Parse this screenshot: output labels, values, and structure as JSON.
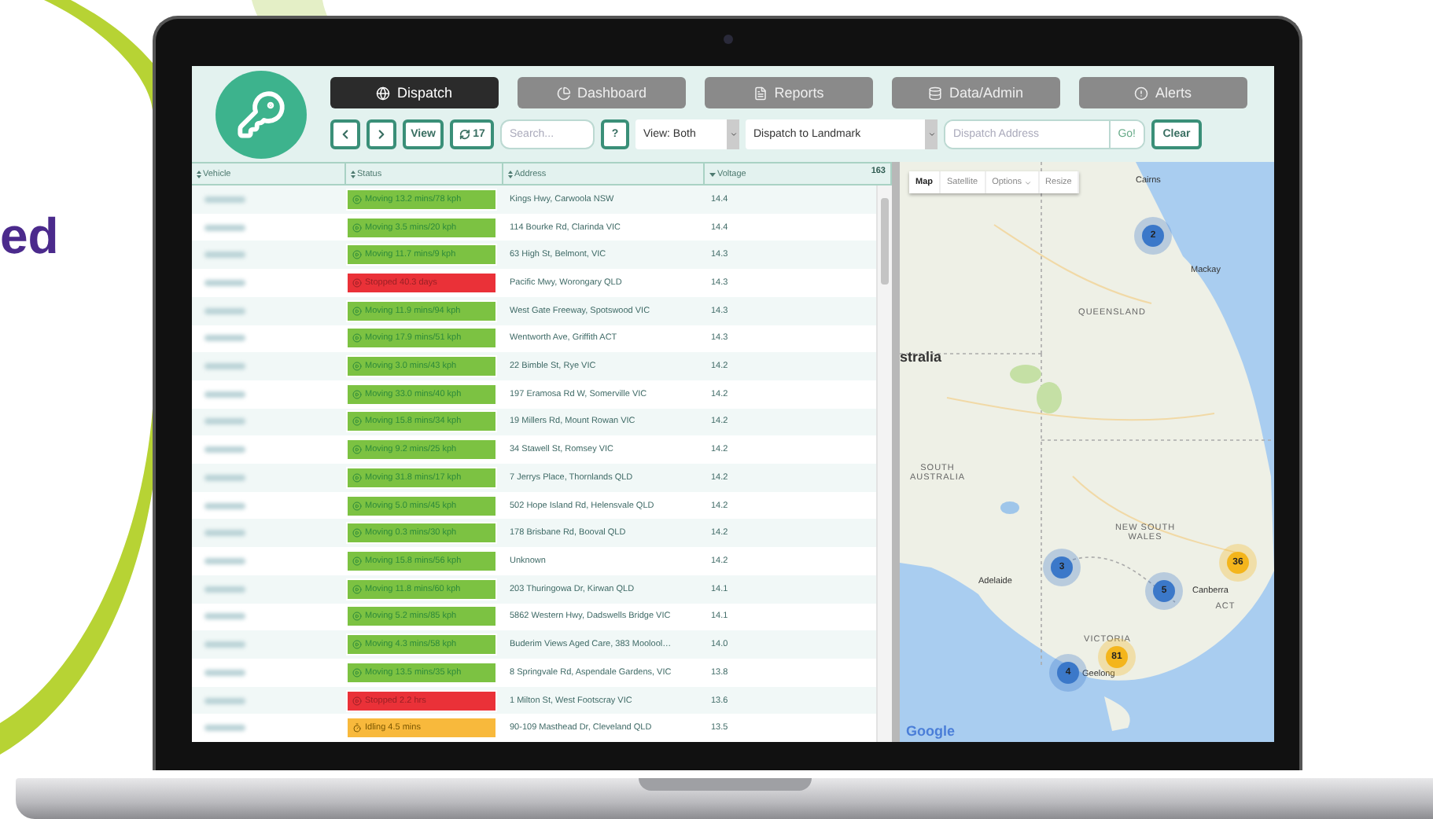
{
  "side_text": "ed",
  "nav": [
    {
      "label": "Dispatch",
      "selected": true
    },
    {
      "label": "Dashboard",
      "selected": false
    },
    {
      "label": "Reports",
      "selected": false
    },
    {
      "label": "Data/Admin",
      "selected": false
    },
    {
      "label": "Alerts",
      "selected": false
    }
  ],
  "toolbar": {
    "view_button": "View",
    "refresh_count": "17",
    "search": {
      "placeholder": "Search..."
    },
    "help_button": "?",
    "view_select": "View: Both",
    "dispatch_select": "Dispatch to Landmark",
    "address": {
      "placeholder": "Dispatch Address"
    },
    "go_button": "Go!",
    "clear_button": "Clear"
  },
  "table": {
    "columns": [
      {
        "label": "Vehicle",
        "sorted": false
      },
      {
        "label": "Status",
        "sorted": false
      },
      {
        "label": "Address",
        "sorted": false
      },
      {
        "label": "Voltage",
        "sorted": true
      }
    ],
    "count": "163",
    "rows": [
      {
        "status": {
          "kind": "moving",
          "text": "Moving 13.2 mins/78 kph"
        },
        "address": "Kings Hwy, Carwoola NSW",
        "voltage": "14.4"
      },
      {
        "status": {
          "kind": "moving",
          "text": "Moving 3.5 mins/20 kph"
        },
        "address": "114 Bourke Rd, Clarinda VIC",
        "voltage": "14.4"
      },
      {
        "status": {
          "kind": "moving",
          "text": "Moving 11.7 mins/9 kph"
        },
        "address": "63 High St, Belmont, VIC",
        "voltage": "14.3"
      },
      {
        "status": {
          "kind": "stopped",
          "text": "Stopped 40.3 days"
        },
        "address": "Pacific Mwy, Worongary QLD",
        "voltage": "14.3"
      },
      {
        "status": {
          "kind": "moving",
          "text": "Moving 11.9 mins/94 kph"
        },
        "address": "West Gate Freeway, Spotswood VIC",
        "voltage": "14.3"
      },
      {
        "status": {
          "kind": "moving",
          "text": "Moving 17.9 mins/51 kph"
        },
        "address": "Wentworth Ave, Griffith ACT",
        "voltage": "14.3"
      },
      {
        "status": {
          "kind": "moving",
          "text": "Moving 3.0 mins/43 kph"
        },
        "address": "22 Bimble St, Rye VIC",
        "voltage": "14.2"
      },
      {
        "status": {
          "kind": "moving",
          "text": "Moving 33.0 mins/40 kph"
        },
        "address": "197 Eramosa Rd W, Somerville VIC",
        "voltage": "14.2"
      },
      {
        "status": {
          "kind": "moving",
          "text": "Moving 15.8 mins/34 kph"
        },
        "address": "19 Millers Rd, Mount Rowan VIC",
        "voltage": "14.2"
      },
      {
        "status": {
          "kind": "moving",
          "text": "Moving 9.2 mins/25 kph"
        },
        "address": "34 Stawell St, Romsey VIC",
        "voltage": "14.2"
      },
      {
        "status": {
          "kind": "moving",
          "text": "Moving 31.8 mins/17 kph"
        },
        "address": "7 Jerrys Place, Thornlands QLD",
        "voltage": "14.2"
      },
      {
        "status": {
          "kind": "moving",
          "text": "Moving 5.0 mins/45 kph"
        },
        "address": "502 Hope Island Rd, Helensvale QLD",
        "voltage": "14.2"
      },
      {
        "status": {
          "kind": "moving",
          "text": "Moving 0.3 mins/30 kph"
        },
        "address": "178 Brisbane Rd, Booval QLD",
        "voltage": "14.2"
      },
      {
        "status": {
          "kind": "moving",
          "text": "Moving 15.8 mins/56 kph"
        },
        "address": "Unknown",
        "voltage": "14.2"
      },
      {
        "status": {
          "kind": "moving",
          "text": "Moving 11.8 mins/60 kph"
        },
        "address": "203 Thuringowa Dr, Kirwan QLD",
        "voltage": "14.1"
      },
      {
        "status": {
          "kind": "moving",
          "text": "Moving 5.2 mins/85 kph"
        },
        "address": "5862 Western Hwy, Dadswells Bridge VIC",
        "voltage": "14.1"
      },
      {
        "status": {
          "kind": "moving",
          "text": "Moving 4.3 mins/58 kph"
        },
        "address": "Buderim Views Aged Care, 383 Moolool…",
        "voltage": "14.0"
      },
      {
        "status": {
          "kind": "moving",
          "text": "Moving 13.5 mins/35 kph"
        },
        "address": "8 Springvale Rd, Aspendale Gardens, VIC",
        "voltage": "13.8"
      },
      {
        "status": {
          "kind": "stopped",
          "text": "Stopped 2.2 hrs"
        },
        "address": "1 Milton St, West Footscray VIC",
        "voltage": "13.6"
      },
      {
        "status": {
          "kind": "idling",
          "text": "Idling 4.5 mins"
        },
        "address": "90-109 Masthead Dr, Cleveland QLD",
        "voltage": "13.5"
      }
    ]
  },
  "map": {
    "controls": [
      {
        "label": "Map",
        "selected": true
      },
      {
        "label": "Satellite",
        "selected": false
      },
      {
        "label": "Options",
        "selected": false
      },
      {
        "label": "Resize",
        "selected": false
      }
    ],
    "labels": [
      {
        "text": "Cairns",
        "kind": "city"
      },
      {
        "text": "Mackay",
        "kind": "city"
      },
      {
        "text": "QUEENSLAND",
        "kind": "state"
      },
      {
        "text": "stralia",
        "kind": "country"
      },
      {
        "text": "SOUTH AUSTRALIA",
        "kind": "state"
      },
      {
        "text": "NEW SOUTH WALES",
        "kind": "state"
      },
      {
        "text": "Adelaide",
        "kind": "city"
      },
      {
        "text": "Canberra",
        "kind": "city"
      },
      {
        "text": "ACT",
        "kind": "state"
      },
      {
        "text": "VICTORIA",
        "kind": "state"
      },
      {
        "text": "Geelong",
        "kind": "city"
      }
    ],
    "clusters": [
      {
        "count": "2",
        "color": "#3b78c9"
      },
      {
        "count": "3",
        "color": "#3b78c9"
      },
      {
        "count": "5",
        "color": "#3b78c9"
      },
      {
        "count": "4",
        "color": "#3b78c9"
      },
      {
        "count": "81",
        "color": "#f4b51c"
      },
      {
        "count": "36",
        "color": "#f4b51c"
      }
    ],
    "logo": "Google"
  }
}
